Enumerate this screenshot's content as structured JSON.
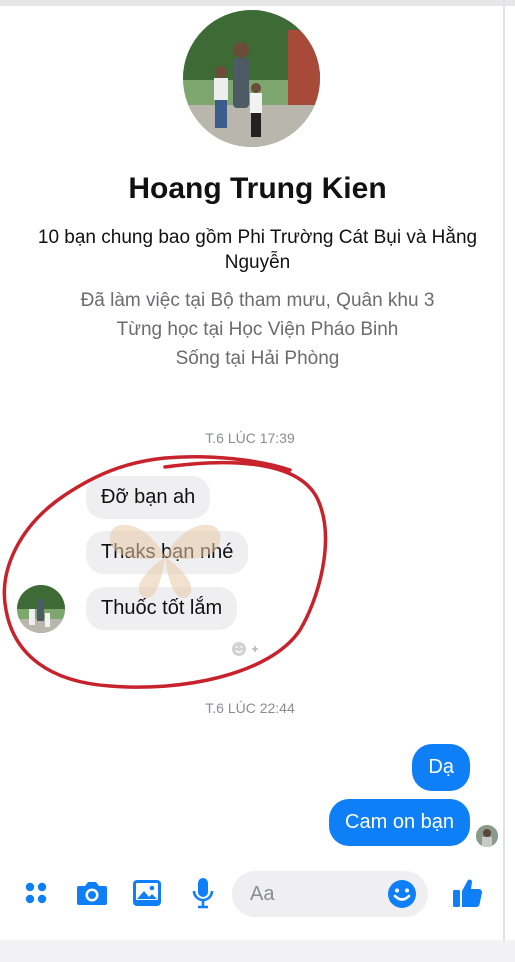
{
  "profile": {
    "name": "Hoang Trung Kien",
    "mutual_friends": "10 bạn chung bao gồm Phi Trường Cát Bụi và Hằng Nguyễn",
    "work": "Đã làm việc tại Bộ tham mưu, Quân khu 3",
    "education": "Từng học tại Học Viện Pháo Binh",
    "lives": "Sống tại Hải Phòng"
  },
  "timestamps": [
    "T.6 LÚC 17:39",
    "T.6 LÚC 22:44"
  ],
  "incoming_messages": [
    "Đỡ bạn ah",
    "Thaks bạn nhé",
    "Thuốc tốt lắm"
  ],
  "outgoing_messages": [
    "Dạ",
    "Cam on bạn"
  ],
  "composer": {
    "placeholder": "Aa"
  },
  "colors": {
    "accent": "#0f7ff7",
    "annotation": "#c8232c",
    "bubble_in": "#efeff1"
  },
  "icons": [
    "menu-dots-icon",
    "camera-icon",
    "image-icon",
    "microphone-icon",
    "emoji-icon",
    "thumbs-up-icon",
    "add-reaction-icon"
  ]
}
